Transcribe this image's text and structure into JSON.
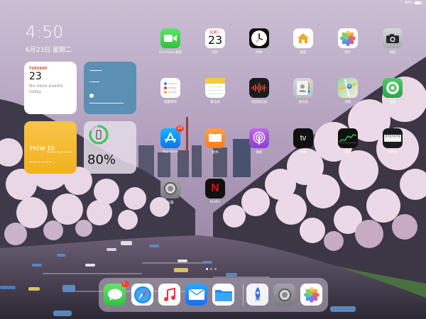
{
  "status": {
    "battery": "80%"
  },
  "lock": {
    "time": "4:50",
    "date": "6月23日 星期二"
  },
  "widgets": {
    "calendar": {
      "day": "TUESDAY",
      "date": "23",
      "events": "No more events today"
    },
    "tips": {
      "title": "How to"
    },
    "battery": {
      "percent": "80%",
      "level": 0.8
    }
  },
  "apps": [
    {
      "name": "FaceTime 通話",
      "icon": "facetime-icon"
    },
    {
      "name": "日历",
      "icon": "calendar-icon",
      "weekday": "星期二",
      "day": "23"
    },
    {
      "name": "时钟",
      "icon": "clock-icon"
    },
    {
      "name": "家庭",
      "icon": "home-icon"
    },
    {
      "name": "照片",
      "icon": "photos-icon"
    },
    {
      "name": "相机",
      "icon": "camera-icon"
    },
    {
      "name": "提醒事项",
      "icon": "reminders-icon"
    },
    {
      "name": "备忘录",
      "icon": "notes-icon"
    },
    {
      "name": "语音备忘录",
      "icon": "voice-memos-icon"
    },
    {
      "name": "通讯录",
      "icon": "contacts-icon"
    },
    {
      "name": "地图",
      "icon": "maps-icon"
    },
    {
      "name": "查找",
      "icon": "find-my-icon"
    },
    {
      "name": "App Store",
      "icon": "app-store-icon",
      "badge": "24"
    },
    {
      "name": "图书",
      "icon": "books-icon"
    },
    {
      "name": "播客",
      "icon": "podcasts-icon"
    },
    {
      "name": "视频",
      "icon": "tv-icon",
      "icon_text": "tv"
    },
    {
      "name": "股市",
      "icon": "stocks-icon"
    },
    {
      "name": "测距仪",
      "icon": "measure-icon"
    },
    {
      "name": "设置",
      "icon": "settings-icon"
    },
    {
      "name": "Netflix",
      "icon": "netflix-icon",
      "icon_text": "N"
    }
  ],
  "dock": [
    {
      "name": "Messages",
      "icon": "messages-icon",
      "badge": "1"
    },
    {
      "name": "Safari",
      "icon": "safari-icon"
    },
    {
      "name": "Music",
      "icon": "music-icon"
    },
    {
      "name": "Mail",
      "icon": "mail-icon"
    },
    {
      "name": "Files",
      "icon": "files-icon"
    },
    {
      "name": "TestFlight",
      "icon": "rocket-icon"
    },
    {
      "name": "Settings",
      "icon": "settings-icon"
    },
    {
      "name": "Photos",
      "icon": "photos-icon"
    }
  ],
  "page_dots": {
    "count": 3,
    "active": 1
  }
}
